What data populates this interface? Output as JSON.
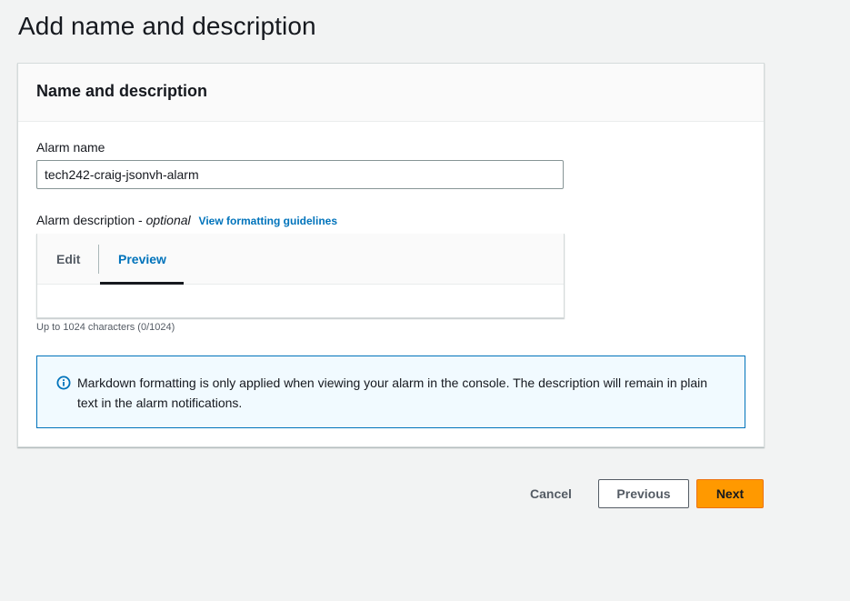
{
  "page": {
    "title": "Add name and description"
  },
  "card": {
    "title": "Name and description",
    "alarm_name": {
      "label": "Alarm name",
      "value": "tech242-craig-jsonvh-alarm"
    },
    "alarm_description": {
      "label": "Alarm description - ",
      "optional": "optional",
      "link": "View formatting guidelines",
      "tabs": [
        {
          "label": "Edit",
          "active": false
        },
        {
          "label": "Preview",
          "active": true
        }
      ],
      "constraint": "Up to 1024 characters (0/1024)"
    },
    "info": {
      "icon": "info-icon",
      "text": "Markdown formatting is only applied when viewing your alarm in the console. The description will remain in plain text in the alarm notifications."
    }
  },
  "actions": {
    "cancel": "Cancel",
    "previous": "Previous",
    "next": "Next"
  },
  "colors": {
    "background": "#f2f3f3",
    "link": "#0073bb",
    "primary_button": "#ff9900",
    "info_border": "#0073bb",
    "info_background": "#f1faff"
  }
}
